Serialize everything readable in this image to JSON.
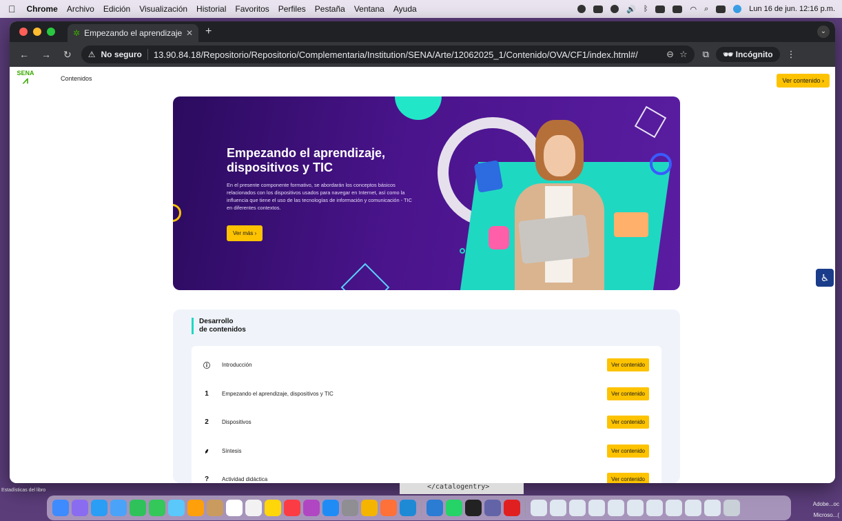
{
  "menubar": {
    "app": "Chrome",
    "items": [
      "Archivo",
      "Edición",
      "Visualización",
      "Historial",
      "Favoritos",
      "Perfiles",
      "Pestaña",
      "Ventana",
      "Ayuda"
    ],
    "clock": "Lun 16 de jun. 12:16 p.m."
  },
  "browser": {
    "tab_title": "Empezando el aprendizaje, di",
    "security_label": "No seguro",
    "url": "13.90.84.18/Repositorio/Repositorio/Complementaria/Institution/SENA/Arte/12062025_1/Contenido/OVA/CF1/index.html#/",
    "incognito_label": "Incógnito"
  },
  "page": {
    "logo_text": "SENA",
    "breadcrumb": "Contenidos",
    "top_button": "Ver contenido ›",
    "hero": {
      "title_line1": "Empezando el aprendizaje,",
      "title_line2": "dispositivos y TIC",
      "description": "En el presente componente formativo, se abordarán los conceptos básicos relacionados con los dispositivos usados para navegar en Internet, así como la influencia que tiene el uso de las tecnologías de información y comunicación - TIC en diferentes contextos.",
      "button": "Ver más ›"
    },
    "section": {
      "title_line1": "Desarrollo",
      "title_line2": "de contenidos",
      "items": [
        {
          "marker": "ⓘ",
          "label": "Introducción",
          "button": "Ver contenido"
        },
        {
          "marker": "1",
          "label": "Empezando el aprendizaje, dispositivos y TIC",
          "button": "Ver contenido"
        },
        {
          "marker": "2",
          "label": "Dispositivos",
          "button": "Ver contenido"
        },
        {
          "marker": "⸙",
          "label": "Síntesis",
          "button": "Ver contenido"
        },
        {
          "marker": "?",
          "label": "Actividad didáctica",
          "button": "Ver contenido"
        }
      ]
    }
  },
  "desktop": {
    "left_label": "Estadísticas del libro",
    "code_line": "</catalogentry>",
    "right_line1": "Adobe...oc",
    "right_line2": "Microso...("
  },
  "colors": {
    "accent_yellow": "#fdc300",
    "sena_green": "#39a900",
    "hero_purple": "#4a148c",
    "teal": "#1fd8c2"
  }
}
